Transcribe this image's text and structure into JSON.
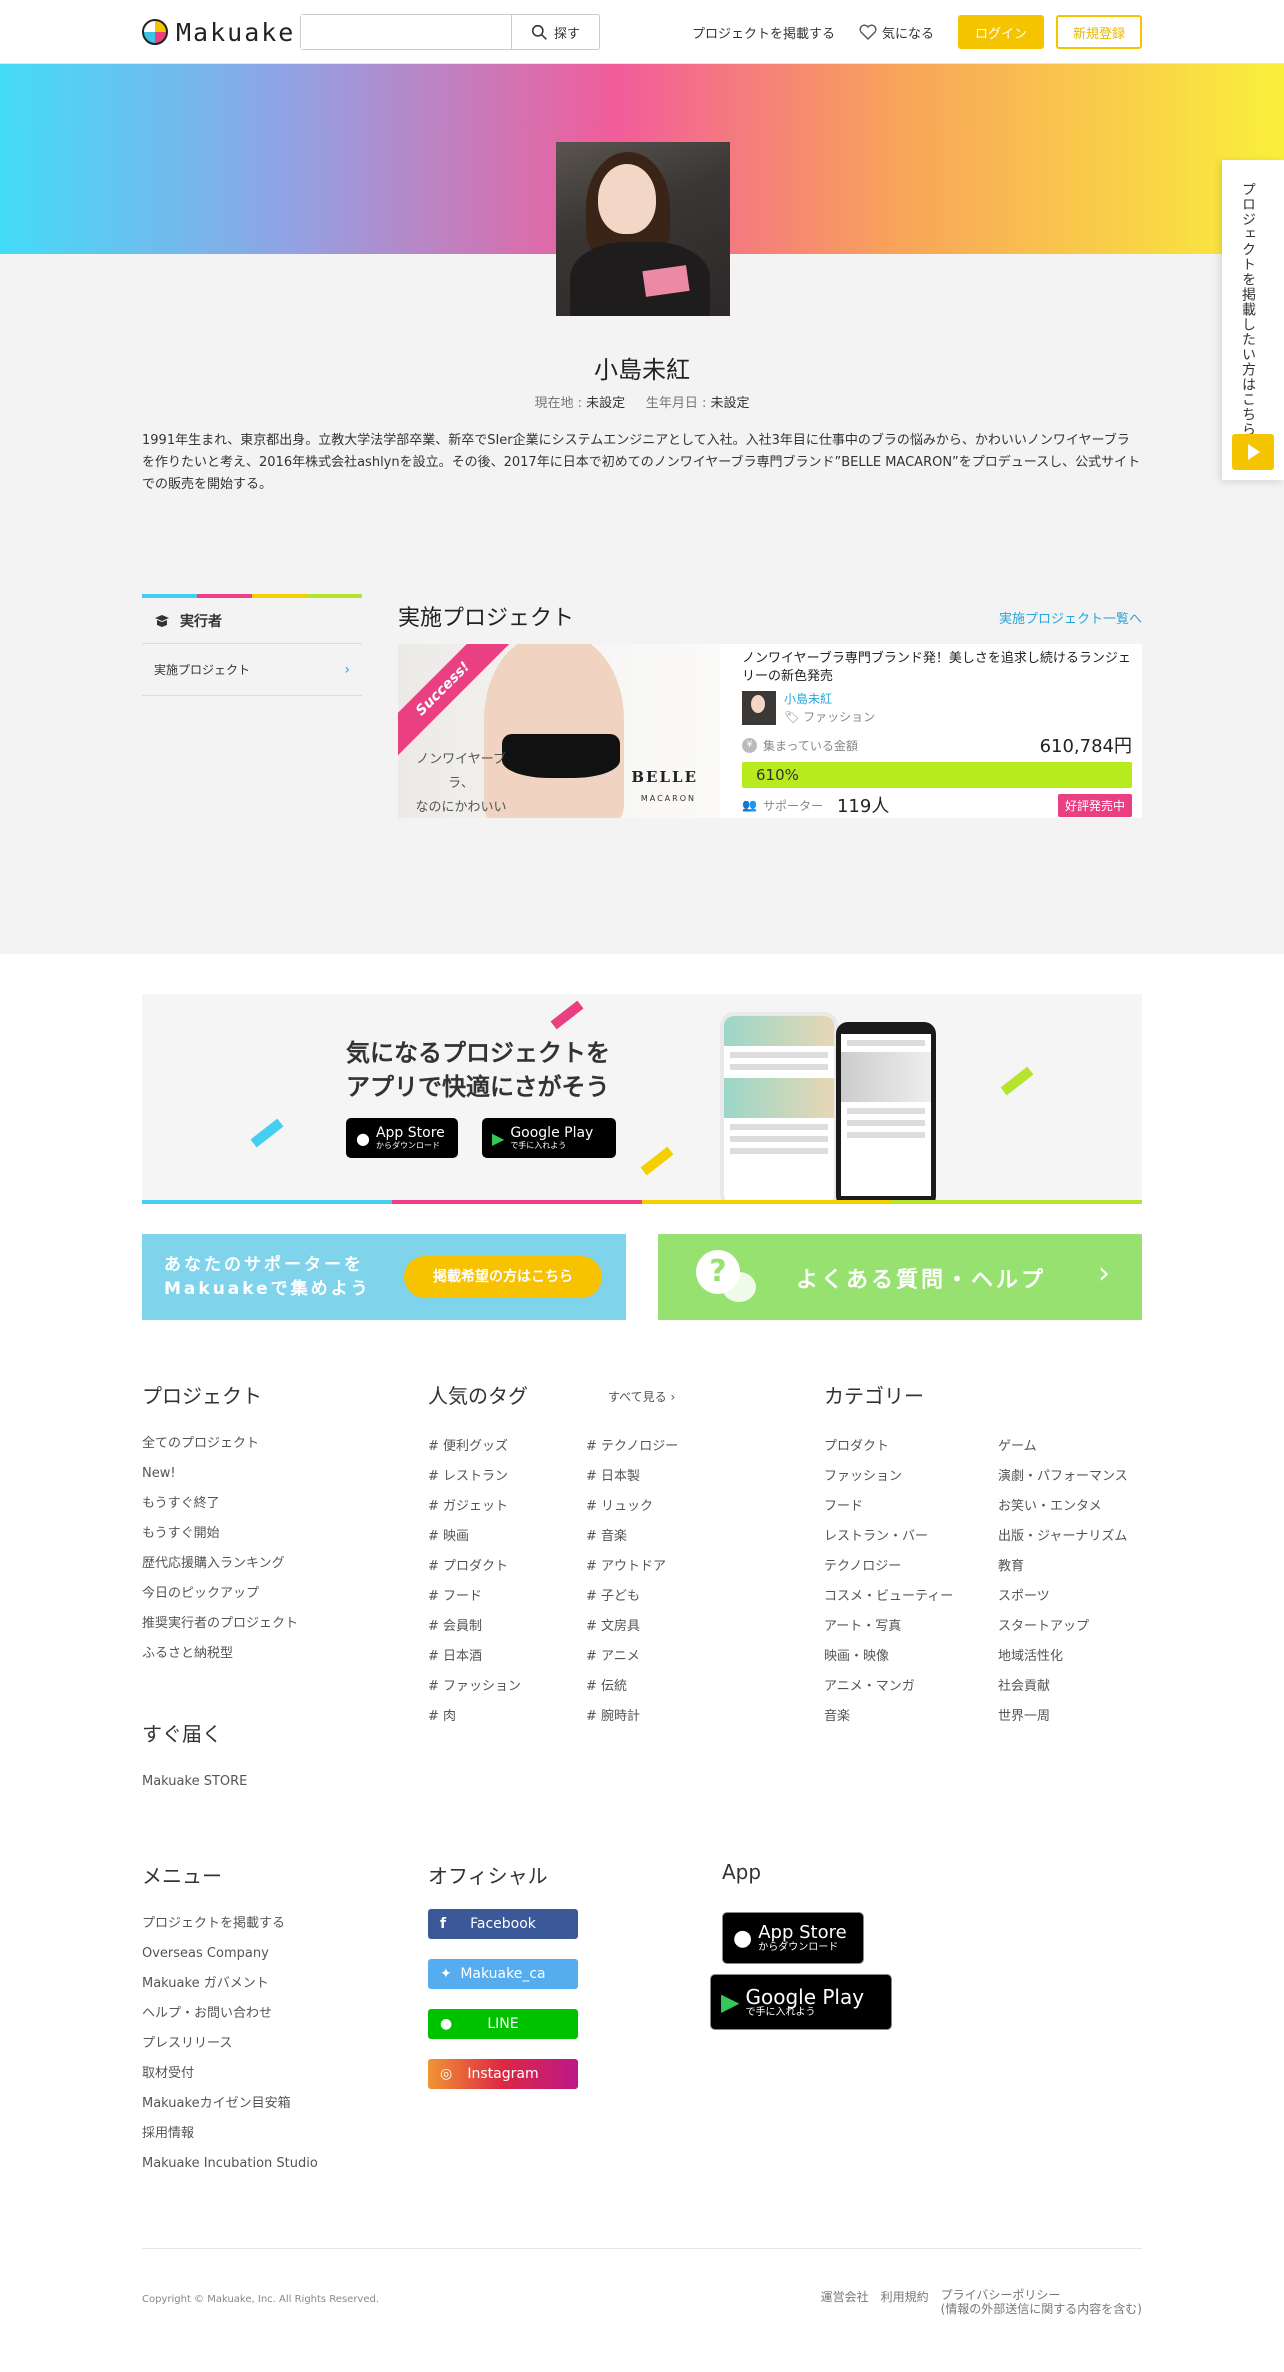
{
  "header": {
    "logo_text": "Makuake",
    "search_placeholder": "",
    "search_label": "探す",
    "post_project": "プロジェクトを掲載する",
    "favorites": "気になる",
    "login": "ログイン",
    "signup": "新規登録"
  },
  "side_tab": {
    "label": "プロジェクトを掲載したい方はこちら"
  },
  "profile": {
    "name": "小島未紅",
    "location_label": "現在地 : ",
    "location_value": "未設定",
    "birthday_label": "生年月日 : ",
    "birthday_value": "未設定",
    "bio": "1991年生まれ、東京都出身。立教大学法学部卒業、新卒でSIer企業にシステムエンジニアとして入社。入社3年目に仕事中のブラの悩みから、かわいいノンワイヤーブラを作りたいと考え、2016年株式会社ashlynを設立。その後、2017年に日本で初めてのノンワイヤーブラ専門ブランド”BELLE MACARON”をプロデュースし、公式サイトでの販売を開始する。"
  },
  "sidebar": {
    "heading": "実行者",
    "items": [
      {
        "label": "実施プロジェクト"
      }
    ]
  },
  "projects": {
    "title": "実施プロジェクト",
    "list_link": "実施プロジェクト一覧へ",
    "card": {
      "ribbon": "Success!",
      "image_caption_1": "ノンワイヤーブラ、",
      "image_caption_2": "なのにかわいい",
      "brand": "BELLE",
      "brand_sub": "MACARON",
      "name": "ノンワイヤーブラ専門ブランド発！美しさを追求し続けるランジェリーの新色発売",
      "owner": "小島未紅",
      "category": "ファッション",
      "money_label": "集まっている金額",
      "money": "610,784円",
      "progress_text": "610%",
      "progress_ratio": 1.0,
      "supporters_label": "サポーター",
      "supporters": "119人",
      "badge": "好評発売中"
    }
  },
  "promo": {
    "title_1": "気になるプロジェクトを",
    "title_2": "アプリで快適にさがそう",
    "appstore_big": "App Store",
    "appstore_small": "からダウンロード",
    "googleplay_big": "Google Play",
    "googleplay_small": "で手に入れよう"
  },
  "banners": {
    "supporter_1": "あなたのサポーターを",
    "supporter_2": "Makuakeで集めよう",
    "supporter_button": "掲載希望の方はこちら",
    "help": "よくある質問・ヘルプ"
  },
  "footer": {
    "project": {
      "heading": "プロジェクト",
      "items": [
        "全てのプロジェクト",
        "New!",
        "もうすぐ終了",
        "もうすぐ開始",
        "歴代応援購入ランキング",
        "今日のピックアップ",
        "推奨実行者のプロジェクト",
        "ふるさと納税型"
      ]
    },
    "soon": {
      "heading": "すぐ届く",
      "items": [
        "Makuake STORE"
      ]
    },
    "tags": {
      "heading": "人気のタグ",
      "see_all": "すべて見る ›",
      "col1": [
        "# 便利グッズ",
        "# レストラン",
        "# ガジェット",
        "# 映画",
        "# プロダクト",
        "# フード",
        "# 会員制",
        "# 日本酒",
        "# ファッション",
        "# 肉"
      ],
      "col2": [
        "# テクノロジー",
        "# 日本製",
        "# リュック",
        "# 音楽",
        "# アウトドア",
        "# 子ども",
        "# 文房具",
        "# アニメ",
        "# 伝統",
        "# 腕時計"
      ]
    },
    "category": {
      "heading": "カテゴリー",
      "col1": [
        "プロダクト",
        "ファッション",
        "フード",
        "レストラン・バー",
        "テクノロジー",
        "コスメ・ビューティー",
        "アート・写真",
        "映画・映像",
        "アニメ・マンガ",
        "音楽"
      ],
      "col2": [
        "ゲーム",
        "演劇・パフォーマンス",
        "お笑い・エンタメ",
        "出版・ジャーナリズム",
        "教育",
        "スポーツ",
        "スタートアップ",
        "地域活性化",
        "社会貢献",
        "世界一周"
      ]
    },
    "menu": {
      "heading": "メニュー",
      "items": [
        "プロジェクトを掲載する",
        "Overseas Company",
        "Makuake ガバメント",
        "ヘルプ・お問い合わせ",
        "プレスリリース",
        "取材受付",
        "Makuakeカイゼン目安箱",
        "採用情報",
        "Makuake Incubation Studio"
      ]
    },
    "official": {
      "heading": "オフィシャル",
      "facebook": "Facebook",
      "twitter": "Makuake_ca",
      "line": "LINE",
      "instagram": "Instagram"
    },
    "app": {
      "heading": "App"
    },
    "copyright": "Copyright © Makuake, Inc. All Rights Reserved.",
    "links": [
      "運営会社",
      "利用規約",
      "プライバシーポリシー",
      "(情報の外部送信に関する内容を含む)"
    ]
  },
  "colors": {
    "accent": "#f5c400",
    "pink": "#ea3f80",
    "link": "#27a5dc",
    "progress": "#b8eb1d"
  }
}
